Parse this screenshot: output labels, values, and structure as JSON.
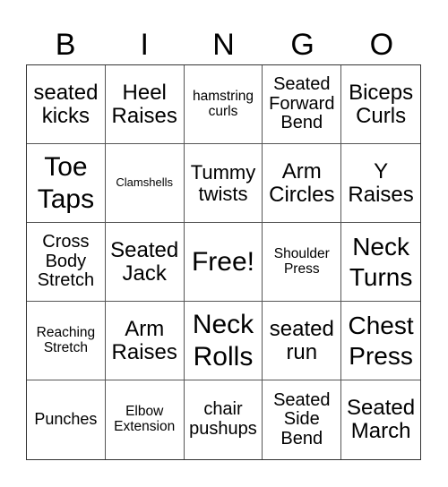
{
  "header": {
    "letters": [
      "B",
      "I",
      "N",
      "G",
      "O"
    ]
  },
  "cells": [
    {
      "text": "seated kicks",
      "size": "l"
    },
    {
      "text": "Heel Raises",
      "size": "l"
    },
    {
      "text": "hamstring curls",
      "size": "s"
    },
    {
      "text": "Seated Forward Bend",
      "size": "m"
    },
    {
      "text": "Biceps Curls",
      "size": "l"
    },
    {
      "text": "Toe Taps",
      "size": "xxl"
    },
    {
      "text": "Clamshells",
      "size": "xs"
    },
    {
      "text": "Tummy twists",
      "size": "ml"
    },
    {
      "text": "Arm Circles",
      "size": "l"
    },
    {
      "text": "Y Raises",
      "size": "l"
    },
    {
      "text": "Cross Body Stretch",
      "size": "m"
    },
    {
      "text": "Seated Jack",
      "size": "l"
    },
    {
      "text": "Free!",
      "size": "xxl"
    },
    {
      "text": "Shoulder Press",
      "size": "s"
    },
    {
      "text": "Neck Turns",
      "size": "xl"
    },
    {
      "text": "Reaching Stretch",
      "size": "s"
    },
    {
      "text": "Arm Raises",
      "size": "l"
    },
    {
      "text": "Neck Rolls",
      "size": "xxl"
    },
    {
      "text": "seated run",
      "size": "l"
    },
    {
      "text": "Chest Press",
      "size": "xl"
    },
    {
      "text": "Punches",
      "size": "sm"
    },
    {
      "text": "Elbow Extension",
      "size": "s"
    },
    {
      "text": "chair pushups",
      "size": "m"
    },
    {
      "text": "Seated Side Bend",
      "size": "m"
    },
    {
      "text": "Seated March",
      "size": "l"
    }
  ]
}
